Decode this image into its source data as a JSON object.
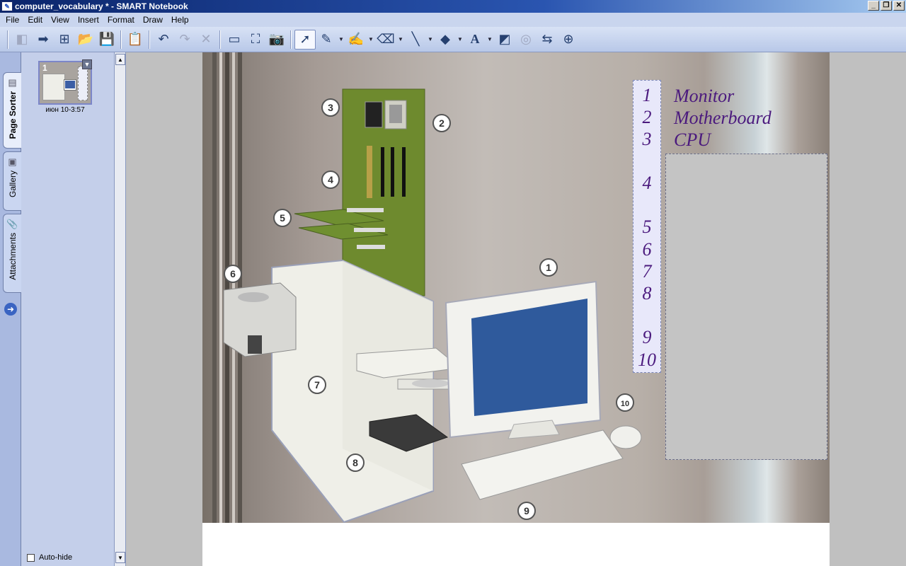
{
  "window": {
    "title": "computer_vocabulary * - SMART Notebook"
  },
  "menu": [
    "File",
    "Edit",
    "View",
    "Insert",
    "Format",
    "Draw",
    "Help"
  ],
  "toolbar": {
    "icons": [
      "previous-page-icon",
      "next-page-icon",
      "add-page-icon",
      "open-icon",
      "save-icon",
      "paste-icon",
      "undo-icon",
      "redo-icon",
      "delete-icon",
      "screen-shade-icon",
      "full-screen-icon",
      "capture-icon",
      "select-icon",
      "pen-icon",
      "highlighter-icon",
      "eraser-icon",
      "line-icon",
      "shape-icon",
      "text-icon",
      "fill-icon",
      "properties-icon",
      "move-toolbar-icon",
      "collapse-icon"
    ]
  },
  "sidebar": {
    "tabs": [
      {
        "label": "Page Sorter"
      },
      {
        "label": "Gallery"
      },
      {
        "label": "Attachments"
      }
    ],
    "page_thumbnail": {
      "number": "1",
      "caption": "июн 10-3:57"
    },
    "autohide_label": "Auto-hide"
  },
  "canvas": {
    "callouts": [
      "1",
      "2",
      "3",
      "4",
      "5",
      "6",
      "7",
      "8",
      "9",
      "10"
    ],
    "numbers": [
      "1",
      "2",
      "3",
      "4",
      "5",
      "6",
      "7",
      "8",
      "9",
      "10"
    ],
    "terms": [
      "Monitor",
      "Motherboard",
      "CPU"
    ]
  },
  "colors": {
    "accent": "#4b1a7e",
    "titlebar": "#0a246a",
    "toolbar": "#c9d5ee"
  }
}
